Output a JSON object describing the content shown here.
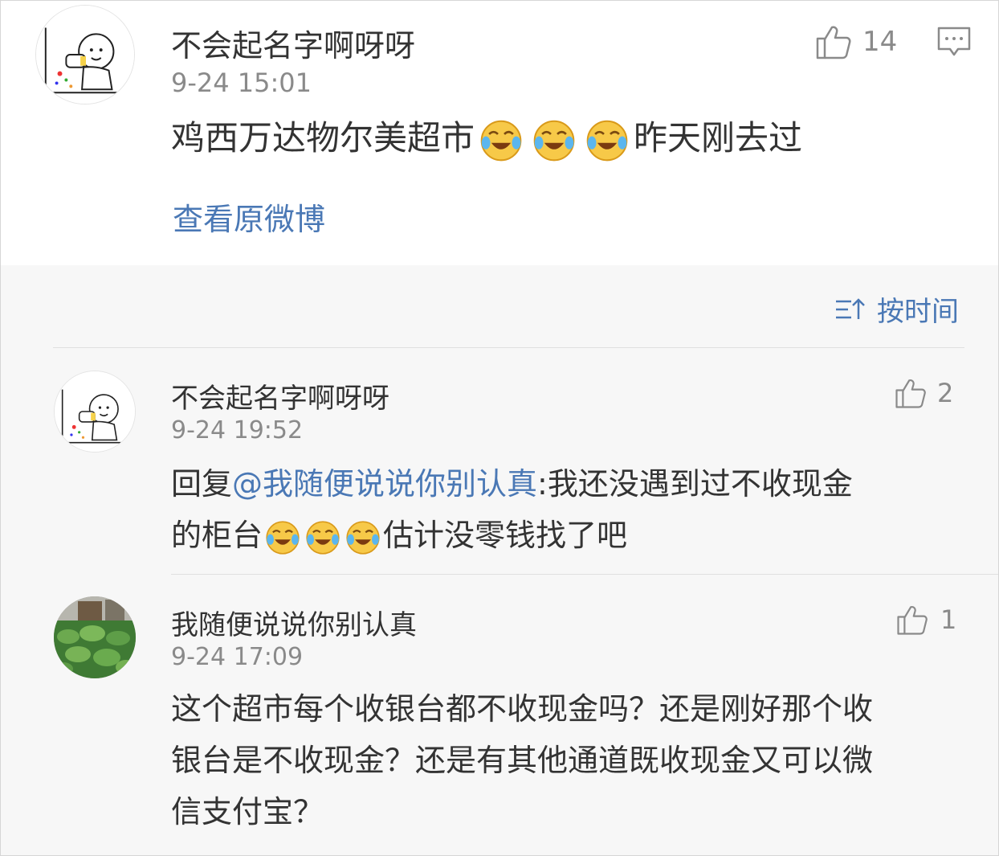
{
  "post": {
    "user": "不会起名字啊呀呀",
    "time": "9-24 15:01",
    "text_before": "鸡西万达物尔美超市",
    "text_after": "昨天刚去过",
    "likes": "14",
    "view_original": "查看原微博"
  },
  "sort": {
    "label": "按时间"
  },
  "replies": [
    {
      "user": "不会起名字啊呀呀",
      "time": "9-24 19:52",
      "prefix": "回复",
      "mention": "@我随便说说你别认真",
      "text": ":我还没遇到过不收现金",
      "line2_before": "的柜台",
      "line2_after": "估计没零钱找了吧",
      "likes": "2"
    },
    {
      "user": "我随便说说你别认真",
      "time": "9-24 17:09",
      "lines": [
        "这个超市每个收银台都不收现金吗？还是刚好那个收",
        "银台是不收现金？还是有其他通道既收现金又可以微",
        "信支付宝？"
      ],
      "likes": "1"
    }
  ],
  "icons": {
    "like": "thumbs-up-icon",
    "comment": "comment-icon",
    "emoji": "laugh-cry-emoji",
    "sort": "sort-icon"
  },
  "colors": {
    "link": "#4a78b5",
    "text": "#333333",
    "muted": "#8a8a8a",
    "background": "#f7f7f7"
  }
}
